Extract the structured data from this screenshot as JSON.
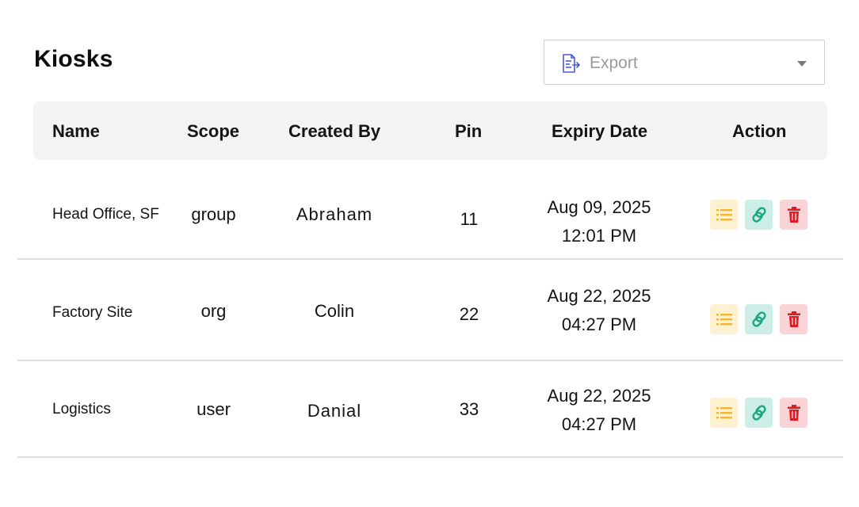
{
  "page": {
    "title": "Kiosks"
  },
  "export": {
    "label": "Export",
    "icon": "export-document-icon",
    "accent": "#4a5bd4"
  },
  "table": {
    "columns": [
      "Name",
      "Scope",
      "Created By",
      "Pin",
      "Expiry Date",
      "Action"
    ],
    "rows": [
      {
        "name": "Head Office, SF",
        "scope": "group",
        "created_by": "Abraham",
        "pin": "11",
        "expiry_date": "Aug 09, 2025",
        "expiry_time": "12:01 PM"
      },
      {
        "name": "Factory Site",
        "scope": "org",
        "created_by": "Colin",
        "pin": "22",
        "expiry_date": "Aug 22, 2025",
        "expiry_time": "04:27 PM"
      },
      {
        "name": "Logistics",
        "scope": "user",
        "created_by": "Danial",
        "pin": "33",
        "expiry_date": "Aug 22, 2025",
        "expiry_time": "04:27 PM"
      }
    ],
    "actions": [
      {
        "name": "details",
        "icon": "list-icon",
        "color": "#f2b630",
        "bg": "#fdf1d2"
      },
      {
        "name": "link",
        "icon": "link-icon",
        "color": "#1aa583",
        "bg": "#cdeee6"
      },
      {
        "name": "delete",
        "icon": "trash-icon",
        "color": "#e01b24",
        "bg": "#f9d3d5"
      }
    ]
  }
}
